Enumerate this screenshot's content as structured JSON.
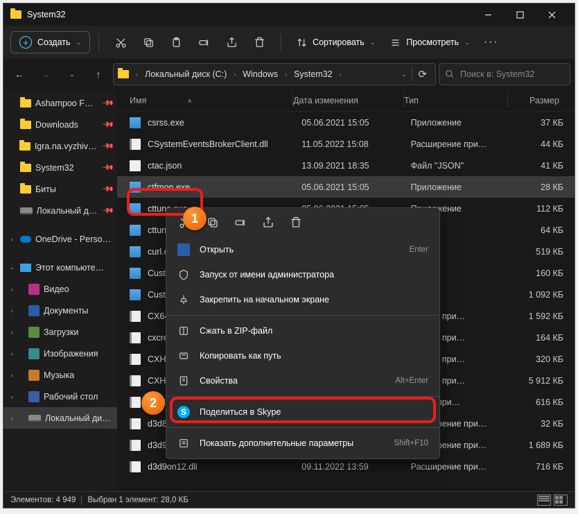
{
  "title": "System32",
  "toolbar": {
    "new": "Создать",
    "sort": "Сортировать",
    "view": "Просмотреть"
  },
  "breadcrumb": [
    "Локальный диск (C:)",
    "Windows",
    "System32"
  ],
  "search_placeholder": "Поиск в: System32",
  "columns": {
    "name": "Имя",
    "date": "Дата изменения",
    "type": "Тип",
    "size": "Размер"
  },
  "sidebar": [
    {
      "label": "Ashampoo F…",
      "icon": "folder",
      "pin": true
    },
    {
      "label": "Downloads",
      "icon": "folder",
      "pin": true
    },
    {
      "label": "Igra.na.vyzhivan…",
      "icon": "folder",
      "pin": true
    },
    {
      "label": "System32",
      "icon": "folder",
      "pin": true
    },
    {
      "label": "Биты",
      "icon": "folder",
      "pin": true
    },
    {
      "label": "Локальный ди…",
      "icon": "drive",
      "pin": true
    },
    {
      "spacer": true
    },
    {
      "label": "OneDrive - Perso…",
      "icon": "onedrive",
      "expandable": true
    },
    {
      "spacer": true
    },
    {
      "label": "Этот компьюте…",
      "icon": "pc",
      "expanded": true
    },
    {
      "label": "Видео",
      "icon": "pink",
      "indent": true,
      "exp": true
    },
    {
      "label": "Документы",
      "icon": "blue",
      "indent": true,
      "exp": true
    },
    {
      "label": "Загрузки",
      "icon": "green",
      "indent": true,
      "exp": true
    },
    {
      "label": "Изображения",
      "icon": "teal",
      "indent": true,
      "exp": true
    },
    {
      "label": "Музыка",
      "icon": "orange",
      "indent": true,
      "exp": true
    },
    {
      "label": "Рабочий стол",
      "icon": "blue2",
      "indent": true,
      "exp": true
    },
    {
      "label": "Локальный ди…",
      "icon": "drive2",
      "indent": true,
      "exp": true,
      "sel": true
    }
  ],
  "files": [
    {
      "name": "csrss.exe",
      "icon": "exe",
      "date": "05.06.2021 15:05",
      "type": "Приложение",
      "size": "37 КБ"
    },
    {
      "name": "CSystemEventsBrokerClient.dll",
      "icon": "dll",
      "date": "11.05.2022 15:08",
      "type": "Расширение при…",
      "size": "44 КБ"
    },
    {
      "name": "ctac.json",
      "icon": "json",
      "date": "13.09.2021 18:35",
      "type": "Файл \"JSON\"",
      "size": "41 КБ"
    },
    {
      "name": "ctfmon.exe",
      "icon": "exe",
      "date": "05.06.2021 15:05",
      "type": "Приложение",
      "size": "28 КБ",
      "sel": true
    },
    {
      "name": "cttune.exe",
      "icon": "exe",
      "date": "05.06.2021 15:05",
      "type": "Приложение",
      "size": "112 КБ"
    },
    {
      "name": "cttunesvr.exe",
      "icon": "exe",
      "date": "",
      "type": "ожение",
      "size": "64 КБ"
    },
    {
      "name": "curl.exe",
      "icon": "exe",
      "date": "",
      "type": "ожение",
      "size": "519 КБ"
    },
    {
      "name": "CustomInstallExec.exe",
      "icon": "exe",
      "date": "",
      "type": "ожение",
      "size": "160 КБ"
    },
    {
      "name": "CustomShellHost.exe",
      "icon": "exe",
      "date": "",
      "type": "ожение",
      "size": "1 092 КБ"
    },
    {
      "name": "CX64APO.dll",
      "icon": "dll",
      "date": "",
      "type": "ирение при…",
      "size": "1 592 КБ"
    },
    {
      "name": "cxcredprov.dll",
      "icon": "dll",
      "date": "",
      "type": "ирение при…",
      "size": "164 КБ"
    },
    {
      "name": "CXH205964APO.dll",
      "icon": "dll",
      "date": "",
      "type": "ирение при…",
      "size": "320 КБ"
    },
    {
      "name": "CXHProvisioningServer.dll",
      "icon": "dll",
      "date": "",
      "type": "ирение при…",
      "size": "5 912 КБ"
    },
    {
      "name": "d2d1debug3.dll",
      "icon": "dll",
      "date": "",
      "type": "рение при…",
      "size": "616 КБ"
    },
    {
      "name": "d3d8thk.dll",
      "icon": "dll",
      "date": "29.11.2022 22:36",
      "type": "Расширение при…",
      "size": "32 КБ"
    },
    {
      "name": "d3d9.dll",
      "icon": "dll",
      "date": "29.11.2022 22:36",
      "type": "Расширение при…",
      "size": "1 689 КБ"
    },
    {
      "name": "d3d9on12.dll",
      "icon": "dll",
      "date": "09.11.2022 13:59",
      "type": "Расширение при…",
      "size": "716 КБ"
    }
  ],
  "context": {
    "open": "Открыть",
    "open_sc": "Enter",
    "runadmin": "Запуск от имени администратора",
    "pin": "Закрепить на начальном экране",
    "zip": "Сжать в ZIP-файл",
    "copypath": "Копировать как путь",
    "props": "Свойства",
    "props_sc": "Alt+Enter",
    "skype": "Поделиться в Skype",
    "more": "Показать дополнительные параметры",
    "more_sc": "Shift+F10"
  },
  "status": {
    "items": "Элементов: 4 949",
    "selected": "Выбран 1 элемент: 28,0 КБ"
  },
  "anno": {
    "b1": "1",
    "b2": "2"
  }
}
